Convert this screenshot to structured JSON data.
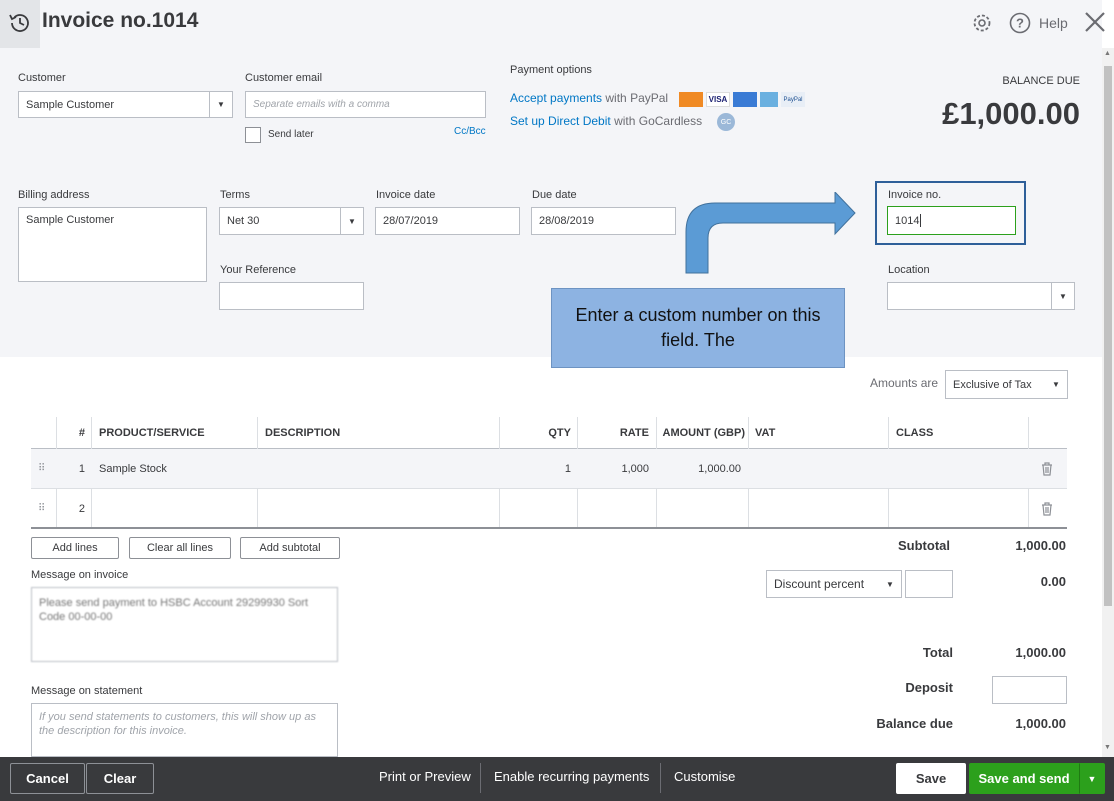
{
  "header": {
    "title": "Invoice no.1014",
    "help_label": "Help"
  },
  "customer": {
    "label": "Customer",
    "value": "Sample Customer",
    "email_label": "Customer email",
    "email_placeholder": "Separate emails with a comma",
    "send_later_label": "Send later",
    "cc_bcc_label": "Cc/Bcc"
  },
  "payment_options": {
    "label": "Payment options",
    "accept_link": "Accept payments",
    "accept_suffix": "with PayPal",
    "direct_debit_link": "Set up Direct Debit",
    "direct_debit_suffix": "with GoCardless",
    "card_icons": [
      "mastercard-icon",
      "visa-icon",
      "maestro-icon",
      "amex-icon",
      "paypal-icon"
    ]
  },
  "balance": {
    "label": "BALANCE DUE",
    "amount": "£1,000.00"
  },
  "billing": {
    "label": "Billing address",
    "value": "Sample Customer"
  },
  "terms": {
    "label": "Terms",
    "value": "Net 30"
  },
  "invoice_date": {
    "label": "Invoice date",
    "value": "28/07/2019"
  },
  "due_date": {
    "label": "Due date",
    "value": "28/08/2019"
  },
  "invoice_no": {
    "label": "Invoice no.",
    "value": "1014"
  },
  "your_reference": {
    "label": "Your Reference",
    "value": ""
  },
  "location": {
    "label": "Location",
    "value": ""
  },
  "callout": {
    "text": "Enter a custom number on this field. The"
  },
  "amounts_are": {
    "label": "Amounts are",
    "value": "Exclusive of Tax"
  },
  "table": {
    "columns": [
      "#",
      "PRODUCT/SERVICE",
      "DESCRIPTION",
      "QTY",
      "RATE",
      "AMOUNT (GBP)",
      "VAT",
      "CLASS"
    ],
    "rows": [
      {
        "num": "1",
        "product": "Sample Stock",
        "description": "",
        "qty": "1",
        "rate": "1,000",
        "amount": "1,000.00",
        "vat": "",
        "class": ""
      },
      {
        "num": "2",
        "product": "",
        "description": "",
        "qty": "",
        "rate": "",
        "amount": "",
        "vat": "",
        "class": ""
      }
    ]
  },
  "table_buttons": {
    "add_lines": "Add lines",
    "clear_all_lines": "Clear all lines",
    "add_subtotal": "Add subtotal"
  },
  "messages": {
    "invoice_label": "Message on invoice",
    "invoice_value": "Please send payment to HSBC Account 29299930 Sort Code 00-00-00",
    "statement_label": "Message on statement",
    "statement_placeholder": "If you send statements to customers, this will show up as the description for this invoice."
  },
  "totals": {
    "subtotal_label": "Subtotal",
    "subtotal_value": "1,000.00",
    "discount_select": "Discount percent",
    "discount_value": "0.00",
    "total_label": "Total",
    "total_value": "1,000.00",
    "deposit_label": "Deposit",
    "balance_due_label": "Balance due",
    "balance_due_value": "1,000.00"
  },
  "footer": {
    "cancel": "Cancel",
    "clear": "Clear",
    "print_preview": "Print or Preview",
    "recurring": "Enable recurring payments",
    "customise": "Customise",
    "save": "Save",
    "save_and_send": "Save and send"
  },
  "colors": {
    "brand_green": "#2ca01c",
    "link_blue": "#0077c5",
    "footer_bg": "#393a3d",
    "callout_blue": "#8db3e2",
    "arrow_blue": "#5b9bd5"
  }
}
